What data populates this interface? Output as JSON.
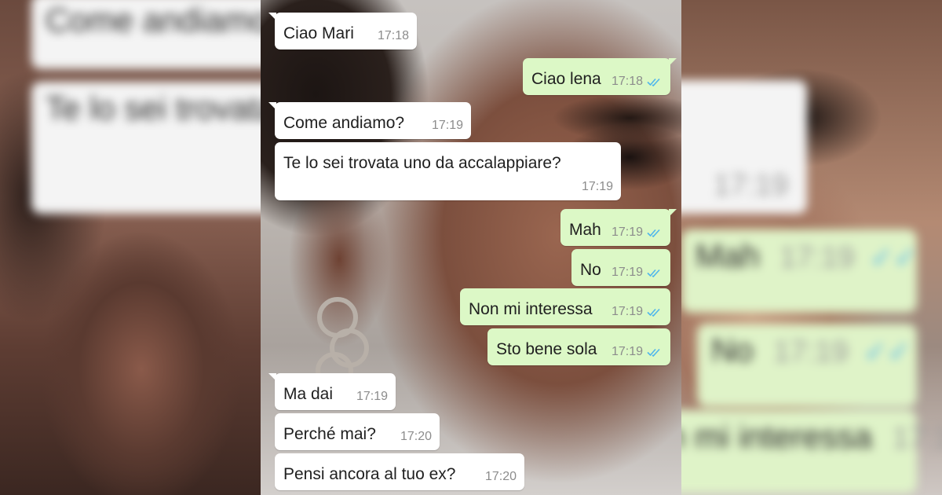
{
  "colors": {
    "incoming_bubble": "#ffffff",
    "outgoing_bubble": "#dcf8c6",
    "read_receipt": "#4fb6ec",
    "timestamp": "#8c8c8c"
  },
  "icons": {
    "read_receipt": "double-check-icon"
  },
  "messages": [
    {
      "direction": "in",
      "text": "Ciao Mari",
      "time": "17:18"
    },
    {
      "direction": "out",
      "text": "Ciao lena",
      "time": "17:18",
      "read": true
    },
    {
      "direction": "in",
      "text": "Come andiamo?",
      "time": "17:19"
    },
    {
      "direction": "in",
      "text": "Te lo sei trovata uno da accalappiare?",
      "time": "17:19"
    },
    {
      "direction": "out",
      "text": "Mah",
      "time": "17:19",
      "read": true
    },
    {
      "direction": "out",
      "text": "No",
      "time": "17:19",
      "read": true
    },
    {
      "direction": "out",
      "text": "Non mi interessa",
      "time": "17:19",
      "read": true
    },
    {
      "direction": "out",
      "text": "Sto bene sola",
      "time": "17:19",
      "read": true
    },
    {
      "direction": "in",
      "text": "Ma dai",
      "time": "17:19"
    },
    {
      "direction": "in",
      "text": "Perché mai?",
      "time": "17:20"
    },
    {
      "direction": "in",
      "text": "Pensi ancora al tuo ex?",
      "time": "17:20"
    }
  ]
}
